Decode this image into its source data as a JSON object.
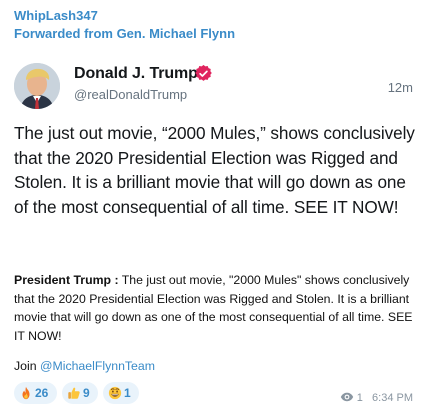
{
  "channel": {
    "sender": "WhipLash347",
    "forwarded_from": "Forwarded from Gen. Michael Flynn"
  },
  "tweet": {
    "display_name": "Donald J. Trump",
    "handle": "@realDonaldTrump",
    "age": "12m",
    "text": "The just out movie, “2000 Mules,” shows conclusively that the 2020 Presidential Election was Rigged and Stolen. It is a brilliant movie that will go down as one of the most consequential of all time. SEE IT NOW!"
  },
  "message": {
    "lead": "President Trump :",
    "text": " The just out movie, \"2000 Mules\" shows conclusively that the 2020 Presidential Election was Rigged and Stolen. It is a brilliant movie that will go down as one of the most consequential of all time. SEE IT NOW!",
    "join_prefix": "Join ",
    "join_link": "@MichaelFlynnTeam"
  },
  "reactions": [
    {
      "emoji_name": "fire-emoji",
      "count": "26"
    },
    {
      "emoji_name": "thumbs-up-emoji",
      "count": "9"
    },
    {
      "emoji_name": "grinning-face-emoji",
      "count": "1"
    }
  ],
  "footer": {
    "views": "1",
    "time": "6:34 PM"
  },
  "colors": {
    "accent": "#3a8bc8",
    "verified_badge": "#e0245e",
    "reaction_bg": "#e9f3fb",
    "muted": "#8a96a1"
  }
}
